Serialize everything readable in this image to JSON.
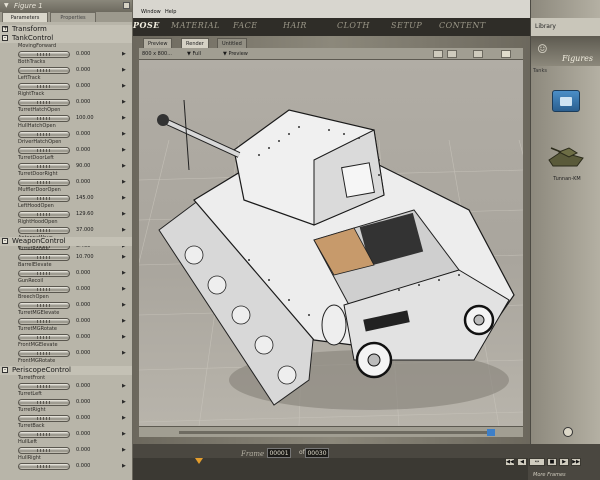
{
  "app": {
    "panel_title": "Figure 1"
  },
  "panel": {
    "tabs": [
      {
        "label": "Parameters"
      },
      {
        "label": "Properties"
      }
    ],
    "groups": [
      {
        "name": "Transform",
        "toggle": "+"
      },
      {
        "name": "TankControl",
        "toggle": "-"
      },
      {
        "name": "WeaponControl",
        "toggle": "-"
      },
      {
        "name": "PeriscopeControl",
        "toggle": "-"
      }
    ],
    "tank_params": [
      {
        "label": "MovingForward",
        "value": "0.000"
      },
      {
        "label": "BothTracks",
        "value": "0.000"
      },
      {
        "label": "LeftTrack",
        "value": "0.000"
      },
      {
        "label": "RightTrack",
        "value": "0.000"
      },
      {
        "label": "TurretHatchOpen",
        "value": "100.00"
      },
      {
        "label": "HullHatchOpen",
        "value": "0.000"
      },
      {
        "label": "DriverHatchOpen",
        "value": "0.000"
      },
      {
        "label": "TurretDoorLeft",
        "value": "90.00"
      },
      {
        "label": "TurretDoorRight",
        "value": "0.000"
      },
      {
        "label": "MufflerDoorOpen",
        "value": "145.00"
      },
      {
        "label": "LeftHoodOpen",
        "value": "129.60"
      },
      {
        "label": "RightHoodOpen",
        "value": "37.000"
      },
      {
        "label": "AntennaWave",
        "value": "0.460"
      }
    ],
    "weapon_params": [
      {
        "label": "TurretRotate",
        "value": "10.700"
      },
      {
        "label": "BarrelElevate",
        "value": "0.000"
      },
      {
        "label": "GunRecoil",
        "value": "0.000"
      },
      {
        "label": "BreechOpen",
        "value": "0.000"
      },
      {
        "label": "TurretMGElevate",
        "value": "0.000"
      },
      {
        "label": "TurretMGRotate",
        "value": "0.000"
      },
      {
        "label": "FrontMGElevate",
        "value": "0.000"
      },
      {
        "label": "FrontMGRotate",
        "value": "0.000"
      }
    ],
    "periscope_params": [
      {
        "label": "TurretFront",
        "value": "0.000"
      },
      {
        "label": "TurretLeft",
        "value": "0.000"
      },
      {
        "label": "TurretRight",
        "value": "0.000"
      },
      {
        "label": "TurretBack",
        "value": "0.000"
      },
      {
        "label": "HullLeft",
        "value": "0.000"
      },
      {
        "label": "HullRight",
        "value": "0.000"
      }
    ]
  },
  "menu": {
    "items": [
      "Window",
      "Help"
    ]
  },
  "room_tabs": [
    {
      "label": "POSE",
      "active": true
    },
    {
      "label": "MATERIAL",
      "active": false
    },
    {
      "label": "FACE",
      "active": false
    },
    {
      "label": "HAIR",
      "active": false
    },
    {
      "label": "CLOTH",
      "active": false
    },
    {
      "label": "SETUP",
      "active": false
    },
    {
      "label": "CONTENT",
      "active": false
    }
  ],
  "viewport": {
    "tabs": [
      {
        "label": "Preview"
      },
      {
        "label": "Render"
      },
      {
        "label": "Untitled"
      }
    ],
    "size": "800 x 800...",
    "mode": "Full",
    "target": "Preview"
  },
  "library": {
    "header": "Library",
    "category": "Figures",
    "crumb": "Tanks",
    "item_label": "Tunnan-KM"
  },
  "timeline": {
    "frame_label": "Frame",
    "current_frame": "00001",
    "total_frames": "00030",
    "more_label": "More Frames"
  },
  "colors": {
    "accent": "#3d7fc8",
    "marker": "#e49d2c",
    "panel": "#b8b5a9"
  }
}
